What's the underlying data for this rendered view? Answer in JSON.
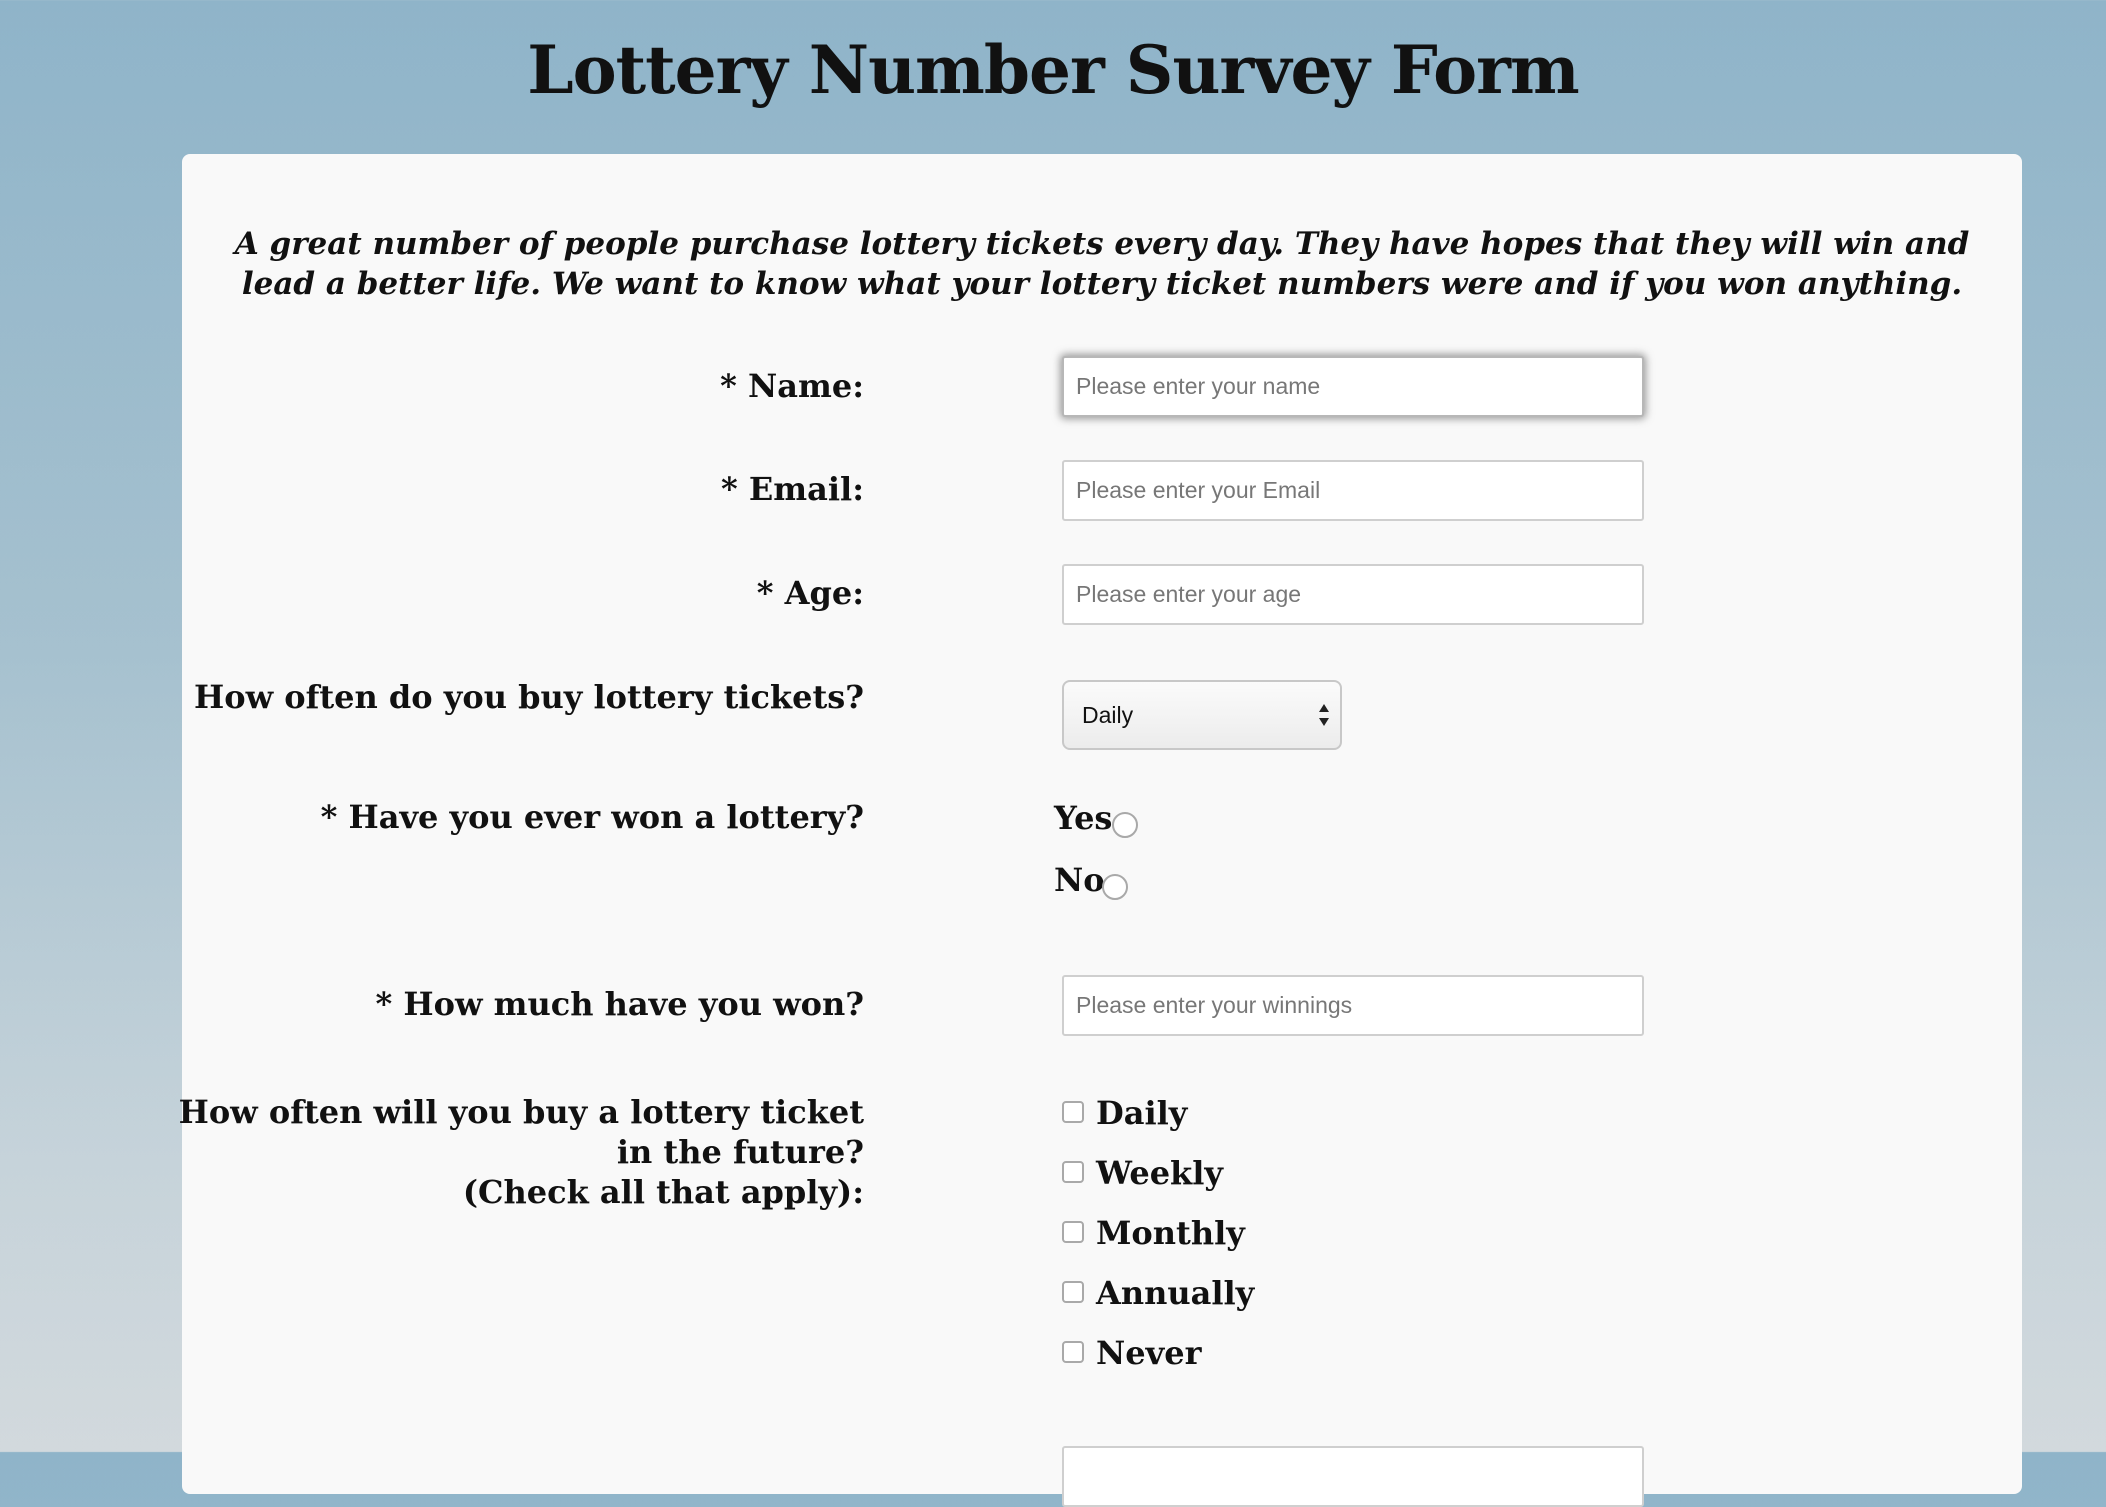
{
  "page": {
    "title": "Lottery Number Survey Form",
    "intro": "A great number of people purchase lottery tickets every day. They have hopes that they will win and lead a better life. We want to know what your lottery ticket numbers were and if you won anything."
  },
  "form": {
    "name": {
      "label": "* Name:",
      "placeholder": "Please enter your name",
      "value": ""
    },
    "email": {
      "label": "* Email:",
      "placeholder": "Please enter your Email",
      "value": ""
    },
    "age": {
      "label": "* Age:",
      "placeholder": "Please enter your age",
      "value": ""
    },
    "frequency": {
      "label": "How often do you buy lottery tickets?",
      "selected": "Daily"
    },
    "won": {
      "label": "* Have you ever won a lottery?",
      "options": [
        "Yes",
        "No"
      ]
    },
    "winnings": {
      "label": "* How much have you won?",
      "placeholder": "Please enter your winnings",
      "value": ""
    },
    "future": {
      "label_line1": "How often will you buy a lottery ticket in the future?",
      "label_line2": "(Check all that apply):",
      "options": [
        "Daily",
        "Weekly",
        "Monthly",
        "Annually",
        "Never"
      ]
    }
  },
  "colors": {
    "background_top": "#8fb4c9",
    "background_bottom": "#d2d9dd",
    "card": "#f9f9f9",
    "text": "#111111"
  }
}
